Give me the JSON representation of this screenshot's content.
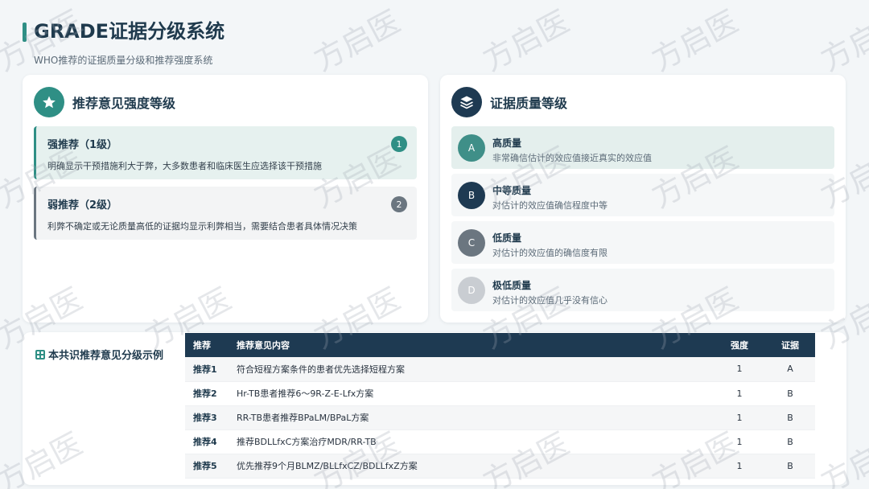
{
  "header": {
    "title": "GRADE证据分级系统",
    "subtitle": "WHO推荐的证据质量分级和推荐强度系统"
  },
  "recommendation_panel": {
    "title": "推荐意见强度等级",
    "icon": "star-icon",
    "items": [
      {
        "title": "强推荐（1级）",
        "desc": "明确显示干预措施利大于弊，大多数患者和临床医生应选择该干预措施",
        "badge": "1"
      },
      {
        "title": "弱推荐（2级）",
        "desc": "利弊不确定或无论质量高低的证据均显示利弊相当，需要结合患者具体情况决策",
        "badge": "2"
      }
    ]
  },
  "quality_panel": {
    "title": "证据质量等级",
    "icon": "layers-icon",
    "items": [
      {
        "letter": "A",
        "title": "高质量",
        "desc": "非常确信估计的效应值接近真实的效应值",
        "color": "#3f8f88"
      },
      {
        "letter": "B",
        "title": "中等质量",
        "desc": "对估计的效应值确信程度中等",
        "color": "#1e3a52"
      },
      {
        "letter": "C",
        "title": "低质量",
        "desc": "对估计的效应值的确信度有限",
        "color": "#6b7680"
      },
      {
        "letter": "D",
        "title": "极低质量",
        "desc": "对估计的效应值几乎没有信心",
        "color": "#c9cdd2"
      }
    ]
  },
  "examples": {
    "label": "本共识推荐意见分级示例",
    "columns": [
      "推荐",
      "推荐意见内容",
      "强度",
      "证据"
    ],
    "rows": [
      [
        "推荐1",
        "符合短程方案条件的患者优先选择短程方案",
        "1",
        "A"
      ],
      [
        "推荐2",
        "Hr-TB患者推荐6～9R-Z-E-Lfx方案",
        "1",
        "B"
      ],
      [
        "推荐3",
        "RR-TB患者推荐BPaLM/BPaL方案",
        "1",
        "B"
      ],
      [
        "推荐4",
        "推荐BDLLfxC方案治疗MDR/RR-TB",
        "1",
        "B"
      ],
      [
        "推荐5",
        "优先推荐9个月BLMZ/BLLfxCZ/BDLLfxZ方案",
        "1",
        "B"
      ]
    ]
  },
  "watermark": "方启医",
  "colors": {
    "accent": "#2f8f85",
    "dark": "#1e3a52",
    "gray": "#6b7680"
  }
}
